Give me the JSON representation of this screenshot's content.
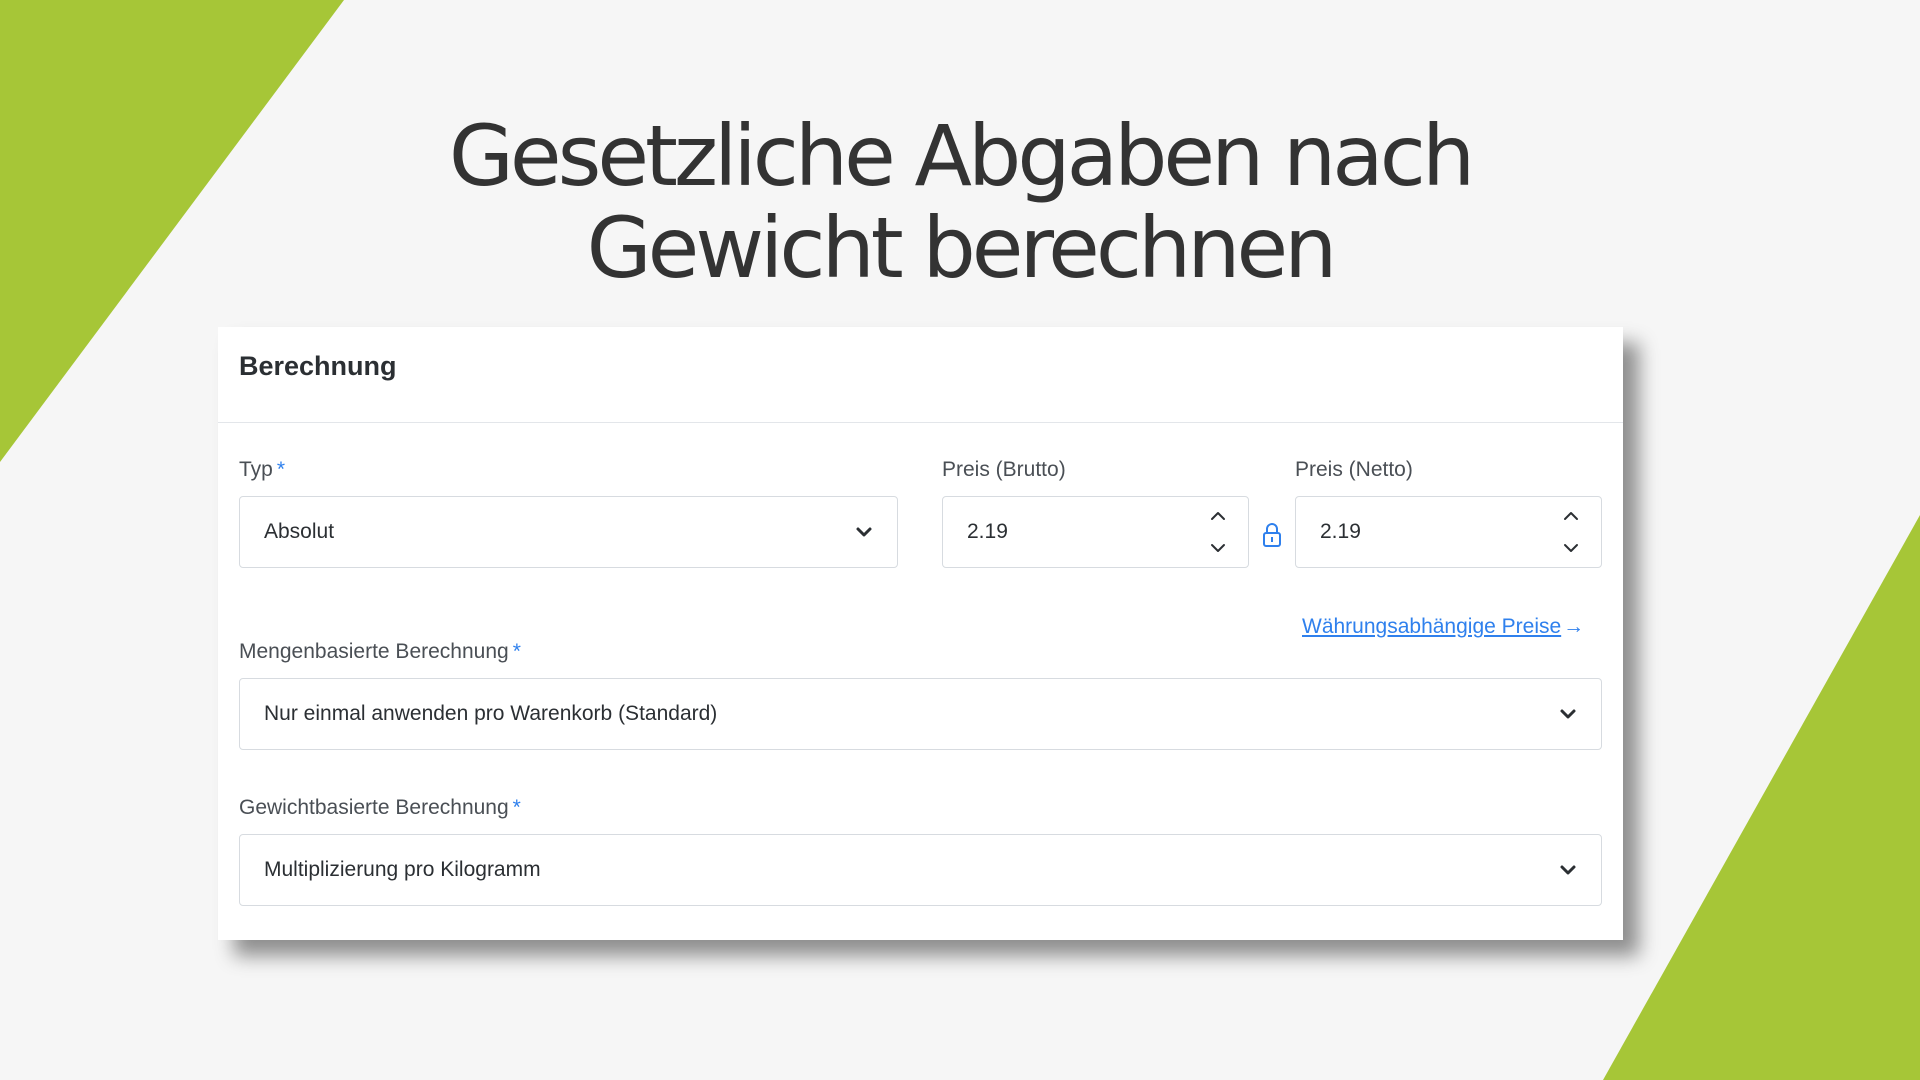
{
  "headline": {
    "line1": "Gesetzliche Abgaben nach",
    "line2": "Gewicht berechnen"
  },
  "colors": {
    "accent_green": "#a6c637",
    "link_blue": "#2f80ed",
    "background": "#f6f6f6"
  },
  "card": {
    "title": "Berechnung",
    "typ": {
      "label": "Typ",
      "required_marker": "*",
      "value": "Absolut",
      "icon": "chevron-down-icon"
    },
    "preis_brutto": {
      "label": "Preis (Brutto)",
      "value": "2.19",
      "icon": "stepper-icon"
    },
    "lock_icon": "lock-icon",
    "preis_netto": {
      "label": "Preis (Netto)",
      "value": "2.19",
      "icon": "stepper-icon"
    },
    "currency_link": {
      "label": "Währungsabhängige Preise",
      "arrow": "→"
    },
    "mengenbasiert": {
      "label": "Mengenbasierte Berechnung",
      "required_marker": "*",
      "value": "Nur einmal anwenden pro Warenkorb (Standard)",
      "icon": "chevron-down-icon"
    },
    "gewichtbasiert": {
      "label": "Gewichtbasierte Berechnung",
      "required_marker": "*",
      "value": "Multiplizierung pro Kilogramm",
      "icon": "chevron-down-icon"
    }
  }
}
